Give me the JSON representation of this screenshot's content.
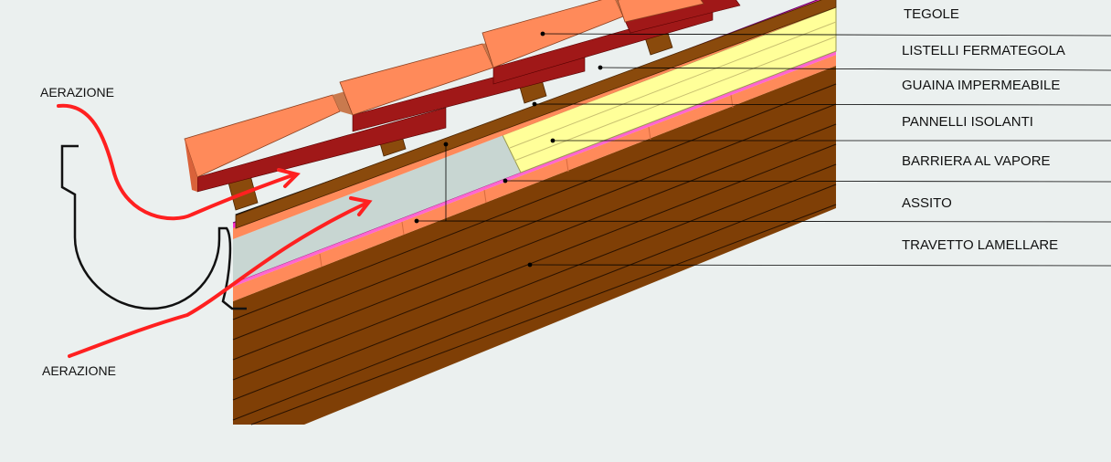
{
  "labels": {
    "tegole": "TEGOLE",
    "listelli": "LISTELLI FERMATEGOLA",
    "guaina": "GUAINA IMPERMEABILE",
    "pannelli": "PANNELLI ISOLANTI",
    "barriera": "BARRIERA AL VAPORE",
    "assito": "ASSITO",
    "travetto": "TRAVETTO LAMELLARE",
    "aerazione_top": "AERAZIONE",
    "aerazione_bottom": "AERAZIONE"
  },
  "colors": {
    "background": "#ebf0ef",
    "tile_face": "#ff8a5a",
    "tile_side": "#c97a4e",
    "tile_under": "#a01818",
    "battens": "#8a4a0c",
    "membrane": "#ff7bd0",
    "board": "#ff8a5a",
    "insulation": "#ffff99",
    "air_gap": "#c8d6d2",
    "beam": "#7f3f06",
    "arrow": "#ff2020",
    "leader": "#000000"
  }
}
